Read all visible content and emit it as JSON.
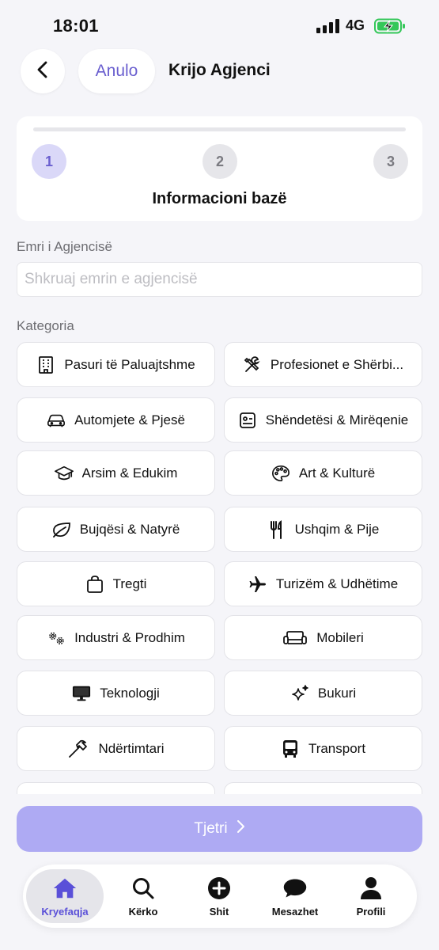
{
  "status_bar": {
    "time": "18:01",
    "network": "4G"
  },
  "header": {
    "cancel_label": "Anulo",
    "title": "Krijo Agjenci"
  },
  "stepper": {
    "steps": [
      "1",
      "2",
      "3"
    ],
    "active_step": 1,
    "current_title": "Informacioni bazë"
  },
  "form": {
    "name_label": "Emri i Agjencisë",
    "name_placeholder": "Shkruaj emrin e agjencisë",
    "name_value": "",
    "category_label": "Kategoria"
  },
  "categories": [
    {
      "label": "Pasuri të Paluajtshme",
      "icon": "building-icon"
    },
    {
      "label": "Profesionet e Shërbi...",
      "icon": "tools-icon"
    },
    {
      "label": "Automjete & Pjesë",
      "icon": "car-icon"
    },
    {
      "label": "Shëndetësi & Mirëqenie",
      "icon": "id-card-icon"
    },
    {
      "label": "Arsim & Edukim",
      "icon": "graduation-cap-icon"
    },
    {
      "label": "Art & Kulturë",
      "icon": "palette-icon"
    },
    {
      "label": "Bujqësi & Natyrë",
      "icon": "leaf-icon"
    },
    {
      "label": "Ushqim & Pije",
      "icon": "fork-knife-icon"
    },
    {
      "label": "Tregti",
      "icon": "shopping-bag-icon"
    },
    {
      "label": "Turizëm & Udhëtime",
      "icon": "airplane-icon"
    },
    {
      "label": "Industri & Prodhim",
      "icon": "gears-icon"
    },
    {
      "label": "Mobileri",
      "icon": "sofa-icon"
    },
    {
      "label": "Teknologji",
      "icon": "monitor-icon"
    },
    {
      "label": "Bukuri",
      "icon": "sparkles-icon"
    },
    {
      "label": "Ndërtimtari",
      "icon": "hammer-icon"
    },
    {
      "label": "Transport",
      "icon": "bus-icon"
    }
  ],
  "next_button": {
    "label": "Tjetri"
  },
  "tab_bar": {
    "active": "Kryefaqja",
    "items": [
      {
        "label": "Kryefaqja",
        "icon": "home-icon"
      },
      {
        "label": "Kërko",
        "icon": "search-icon"
      },
      {
        "label": "Shit",
        "icon": "plus-circle-icon"
      },
      {
        "label": "Mesazhet",
        "icon": "chat-bubble-icon"
      },
      {
        "label": "Profili",
        "icon": "person-icon"
      }
    ]
  },
  "colors": {
    "accent": "#6a5fcf",
    "accent_soft": "#dad8f8",
    "next_disabled": "#aeaaf3",
    "background": "#f5f5f9",
    "tab_active": "#5a50d8"
  }
}
